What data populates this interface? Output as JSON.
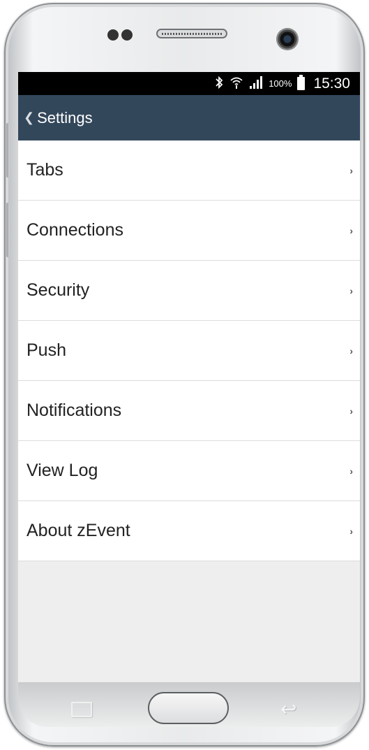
{
  "status_bar": {
    "bluetooth_icon": "bluetooth-icon",
    "wifi_icon": "wifi-icon",
    "signal_icon": "signal-icon",
    "battery_percent": "100%",
    "time": "15:30"
  },
  "nav": {
    "back_icon": "chevron-left-icon",
    "title": "Settings"
  },
  "menu": {
    "items": [
      {
        "label": "Tabs"
      },
      {
        "label": "Connections"
      },
      {
        "label": "Security"
      },
      {
        "label": "Push"
      },
      {
        "label": "Notifications"
      },
      {
        "label": "View Log"
      },
      {
        "label": "About zEvent"
      }
    ],
    "chevron_icon": "chevron-right-icon"
  },
  "colors": {
    "nav_bar": "#33475b",
    "status_bar": "#000000",
    "list_background": "#eeeeee",
    "item_background": "#ffffff"
  }
}
